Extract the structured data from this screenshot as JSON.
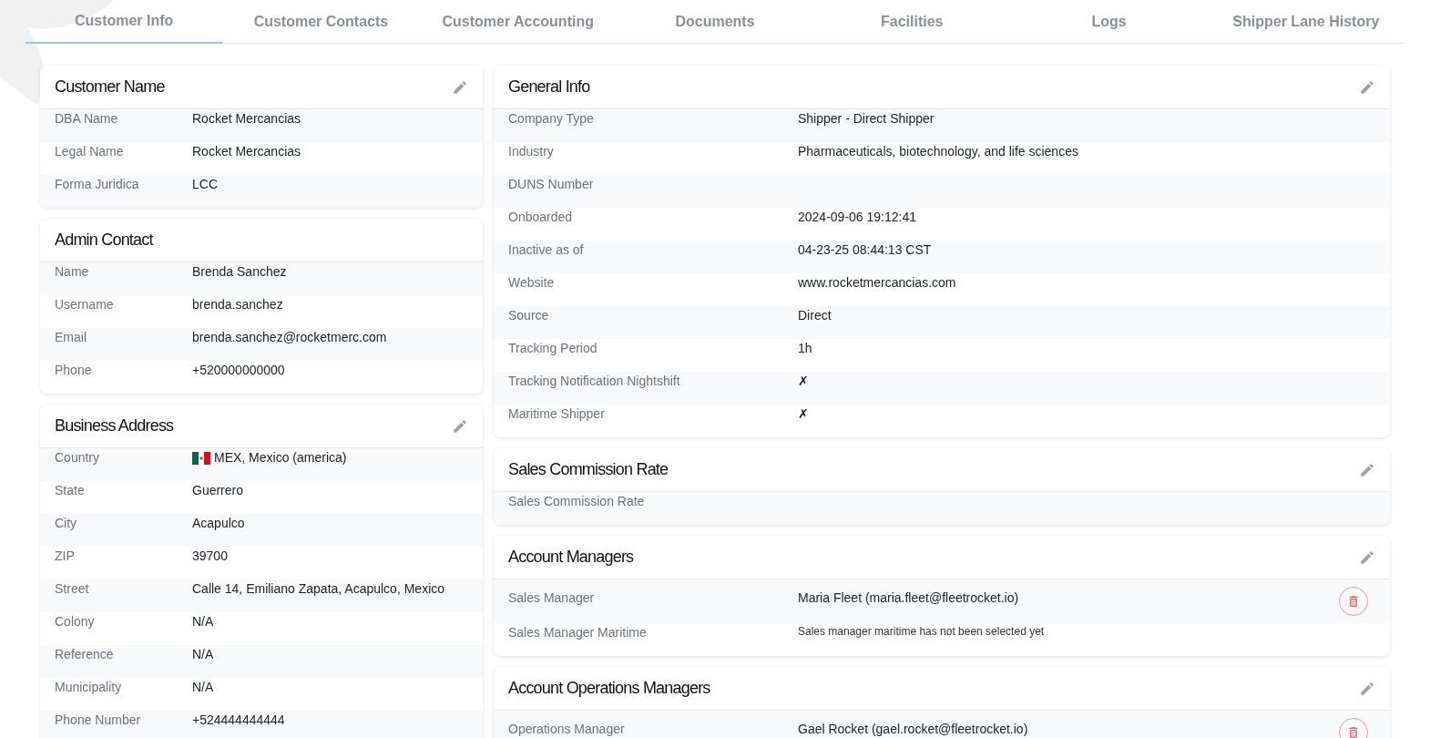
{
  "tabs": [
    {
      "label": "Customer Info",
      "selected": true
    },
    {
      "label": "Customer Contacts",
      "selected": false
    },
    {
      "label": "Customer Accounting",
      "selected": false
    },
    {
      "label": "Documents",
      "selected": false
    },
    {
      "label": "Facilities",
      "selected": false
    },
    {
      "label": "Logs",
      "selected": false
    },
    {
      "label": "Shipper Lane History",
      "selected": false
    }
  ],
  "left_cards": [
    {
      "title": "Customer Name",
      "editable": true,
      "rows": [
        {
          "label": "DBA Name",
          "value": "Rocket Mercancias"
        },
        {
          "label": "Legal Name",
          "value": "Rocket Mercancias"
        },
        {
          "label": "Forma Juridica",
          "value": "LCC"
        }
      ]
    },
    {
      "title": "Admin Contact",
      "editable": false,
      "rows": [
        {
          "label": "Name",
          "value": "Brenda Sanchez"
        },
        {
          "label": "Username",
          "value": "brenda.sanchez"
        },
        {
          "label": "Email",
          "value": "brenda.sanchez@rocketmerc.com"
        },
        {
          "label": "Phone",
          "value": "+520000000000"
        }
      ]
    },
    {
      "title": "Business Address",
      "editable": true,
      "rows": [
        {
          "label": "Country",
          "value": "MEX, Mexico (america)",
          "kind": "flag"
        },
        {
          "label": "State",
          "value": "Guerrero"
        },
        {
          "label": "City",
          "value": "Acapulco"
        },
        {
          "label": "ZIP",
          "value": "39700"
        },
        {
          "label": "Street",
          "value": "Calle 14, Emiliano Zapata, Acapulco, Mexico"
        },
        {
          "label": "Colony",
          "value": "N/A"
        },
        {
          "label": "Reference",
          "value": "N/A"
        },
        {
          "label": "Municipality",
          "value": "N/A"
        },
        {
          "label": "Phone Number",
          "value": "+524444444444"
        }
      ]
    }
  ],
  "right_cards": [
    {
      "title": "General Info",
      "editable": true,
      "rows": [
        {
          "label": "Company Type",
          "value": "Shipper - Direct Shipper"
        },
        {
          "label": "Industry",
          "value": "Pharmaceuticals, biotechnology, and life sciences"
        },
        {
          "label": "DUNS Number"
        },
        {
          "label": "Onboarded",
          "value": "2024-09-06 19:12:41"
        },
        {
          "label": "Inactive as of",
          "value": "04-23-25 08:44:13 CST"
        },
        {
          "label": "Website",
          "value": "www.rocketmercancias.com"
        },
        {
          "label": "Source",
          "value": "Direct"
        },
        {
          "label": "Tracking Period",
          "value": "1h"
        },
        {
          "label": "Tracking Notification Nightshift",
          "value": "✗"
        },
        {
          "label": "Maritime Shipper",
          "value": "✗"
        }
      ]
    },
    {
      "title": "Sales Commission Rate",
      "editable": true,
      "rows": [
        {
          "label": "Sales Commission Rate"
        }
      ]
    },
    {
      "title": "Account Managers",
      "editable": true,
      "rows": [
        {
          "label": "Sales Manager",
          "value": "Maria Fleet (maria.fleet@fleetrocket.io)",
          "deletable": true
        },
        {
          "label": "Sales Manager Maritime",
          "value": "Sales manager maritime has not been selected yet",
          "kind": "note"
        }
      ]
    },
    {
      "title": "Account Operations Managers",
      "editable": true,
      "rows": [
        {
          "label": "Operations Manager",
          "value": "Gael Rocket (gael.rocket@fleetrocket.io)",
          "deletable": true
        }
      ]
    }
  ]
}
